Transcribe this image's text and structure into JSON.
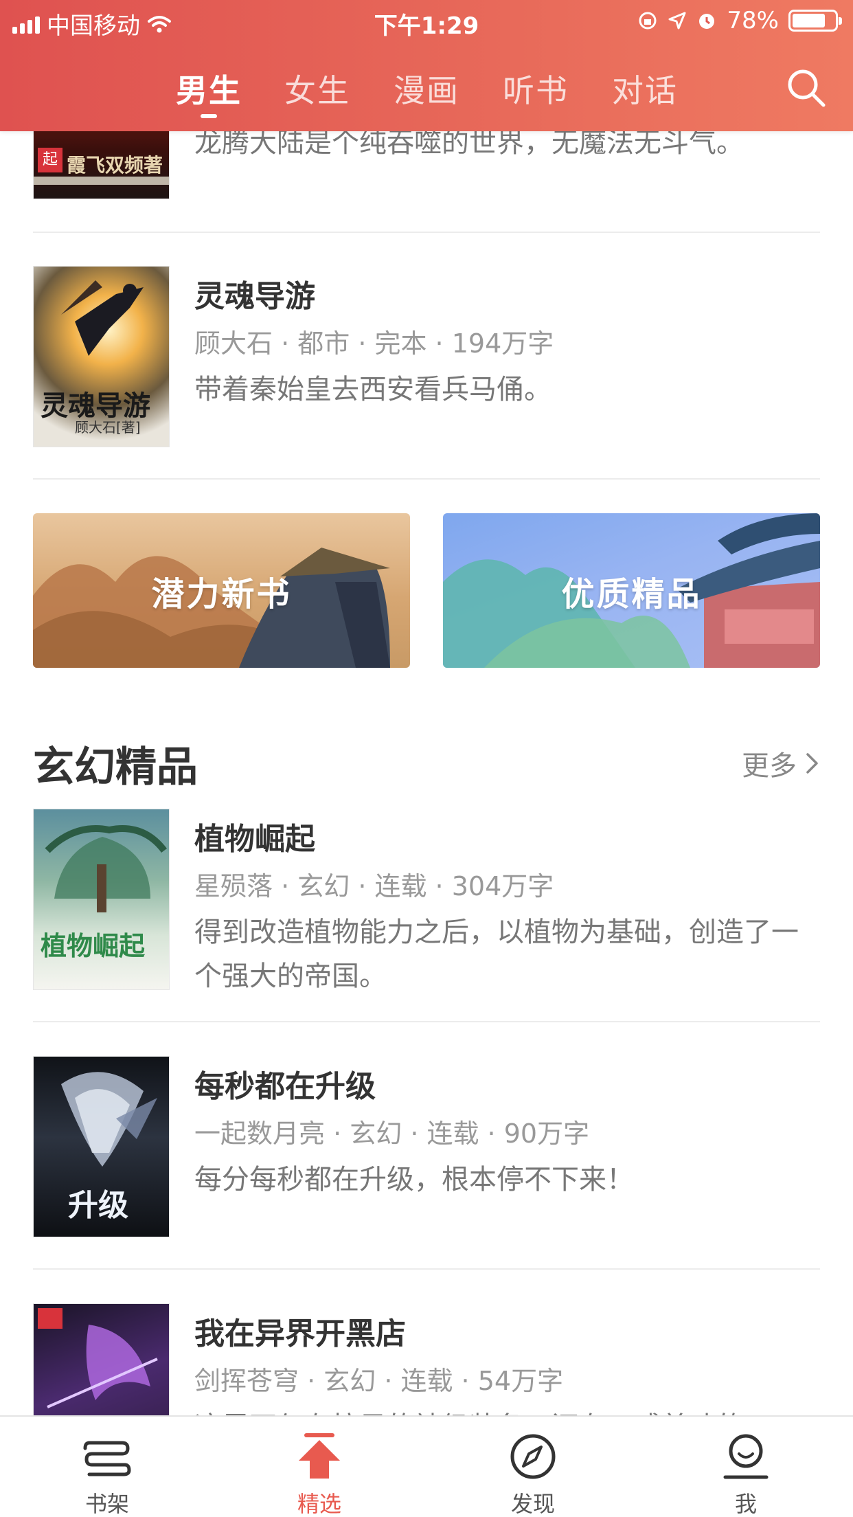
{
  "status_bar": {
    "carrier": "中国移动",
    "time": "下午1:29",
    "battery": "78%",
    "battery_level": 0.78
  },
  "header": {
    "tabs": [
      {
        "label": "男生",
        "active": true
      },
      {
        "label": "女生",
        "active": false
      },
      {
        "label": "漫画",
        "active": false
      },
      {
        "label": "听书",
        "active": false
      },
      {
        "label": "对话",
        "active": false
      }
    ],
    "accent": "#e25a52"
  },
  "top_book": {
    "cover_text": "霞飞双频著",
    "desc": "龙腾大陆是个纯吞噬的世界，无魔法无斗气。"
  },
  "book_linghun": {
    "title": "灵魂导游",
    "meta": "顾大石 · 都市 · 完本 · 194万字",
    "desc": "带着秦始皇去西安看兵马俑。",
    "cover_title": "灵魂导游",
    "cover_author": "顾大石[著]"
  },
  "banners": [
    {
      "label": "潜力新书"
    },
    {
      "label": "优质精品"
    }
  ],
  "section": {
    "title": "玄幻精品",
    "more": "更多"
  },
  "books": [
    {
      "title": "植物崛起",
      "meta": "星殒落 · 玄幻 · 连载 · 304万字",
      "desc": "得到改造植物能力之后，以植物为基础，创造了一个强大的帝国。",
      "cover_title": "植物崛起"
    },
    {
      "title": "每秒都在升级",
      "meta": "一起数月亮 · 玄幻 · 连载 · 90万字",
      "desc": "每分每秒都在升级，根本停不下来！",
      "cover_title": "升级"
    },
    {
      "title": "我在异界开黑店",
      "meta": "剑挥苍穹 · 玄幻 · 连载 · 54万字",
      "desc": "这里不仅有拉风的神级装备，还有口感美味的"
    }
  ],
  "bottom_nav": [
    {
      "label": "书架",
      "icon": "bookshelf-icon",
      "active": false
    },
    {
      "label": "精选",
      "icon": "featured-arrow-icon",
      "active": true
    },
    {
      "label": "发现",
      "icon": "compass-icon",
      "active": false
    },
    {
      "label": "我",
      "icon": "profile-icon",
      "active": false
    }
  ]
}
